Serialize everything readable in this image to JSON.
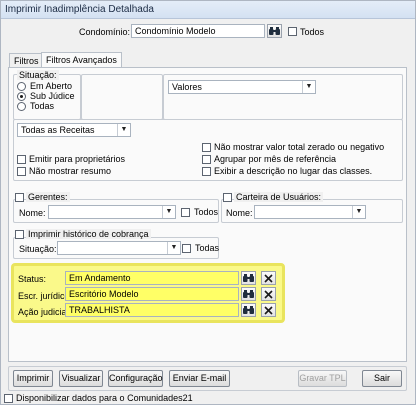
{
  "window": {
    "title": "Imprimir Inadimplência Detalhada"
  },
  "condominio": {
    "label": "Condomínio:",
    "value": "Condomínio Modelo",
    "todos_label": "Todos"
  },
  "tabs": [
    {
      "label": "Filtros"
    },
    {
      "label": "Filtros Avançados"
    }
  ],
  "situacao": {
    "legend": "Situação:",
    "options": [
      {
        "label": "Em Aberto",
        "selected": false
      },
      {
        "label": "Sub Júdice",
        "selected": true
      },
      {
        "label": "Todas",
        "selected": false
      }
    ],
    "valores_select": "Valores"
  },
  "receitas": {
    "select": "Todas as Receitas",
    "emitir_label": "Emitir para proprietários",
    "nao_resumo_label": "Não mostrar resumo",
    "nao_valor_zerado_label": "Não mostrar valor total zerado ou negativo",
    "agrupar_label": "Agrupar por mês de referência",
    "exibir_descricao_label": "Exibir a descrição no lugar das classes."
  },
  "gerentes": {
    "legend": "Gerentes:",
    "nome_label": "Nome:",
    "nome_value": "",
    "todos_label": "Todos"
  },
  "carteira": {
    "legend": "Carteira de Usuários:",
    "nome_label": "Nome:",
    "nome_value": ""
  },
  "historico": {
    "legend": "Imprimir histórico de cobrança",
    "situacao_label": "Situação:",
    "situacao_value": "",
    "todas_label": "Todas"
  },
  "filtros_juridicos": {
    "status_label": "Status:",
    "status_value": "Em Andamento",
    "escritorio_label": "Escr. jurídico:",
    "escritorio_value": "Escritório Modelo",
    "acao_label": "Ação judicial:",
    "acao_value": "TRABALHISTA"
  },
  "buttons": {
    "imprimir": "Imprimir",
    "visualizar": "Visualizar",
    "configuracao": "Configuração",
    "enviar_email": "Enviar E-mail",
    "gravar_tpl": "Gravar TPL",
    "sair": "Sair"
  },
  "comunidades": {
    "label": "Disponibilizar dados para o Comunidades21"
  },
  "colors": {
    "highlight": "#faf98a",
    "highlight_border": "#e9e45d"
  }
}
